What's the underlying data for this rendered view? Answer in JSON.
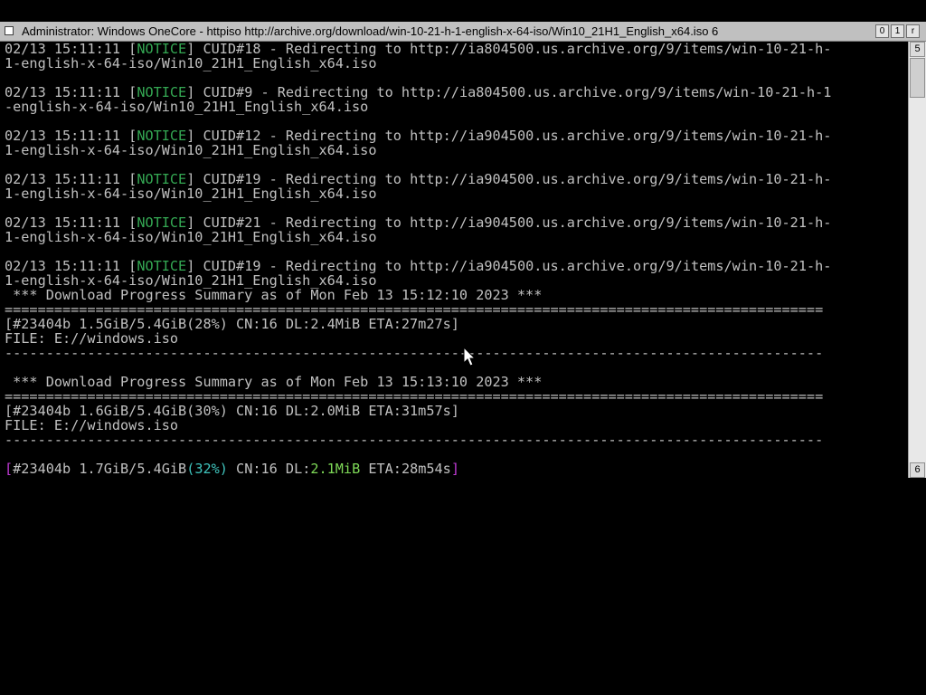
{
  "window": {
    "title": "Administrator:  Windows OneCore - httpiso  http://archive.org/download/win-10-21-h-1-english-x-64-iso/Win10_21H1_English_x64.iso 6",
    "controls": {
      "minimize": "0",
      "maximize": "1",
      "close": "r"
    }
  },
  "console": {
    "log": [
      {
        "time": "02/13 15:11:11",
        "level": "NOTICE",
        "msg": " CUID#18 - Redirecting to http://ia804500.us.archive.org/9/items/win-10-21-h-",
        "wrap": "1-english-x-64-iso/Win10_21H1_English_x64.iso"
      },
      {
        "time": "02/13 15:11:11",
        "level": "NOTICE",
        "msg": " CUID#9 - Redirecting to http://ia804500.us.archive.org/9/items/win-10-21-h-1",
        "wrap": "-english-x-64-iso/Win10_21H1_English_x64.iso"
      },
      {
        "time": "02/13 15:11:11",
        "level": "NOTICE",
        "msg": " CUID#12 - Redirecting to http://ia904500.us.archive.org/9/items/win-10-21-h-",
        "wrap": "1-english-x-64-iso/Win10_21H1_English_x64.iso"
      },
      {
        "time": "02/13 15:11:11",
        "level": "NOTICE",
        "msg": " CUID#19 - Redirecting to http://ia904500.us.archive.org/9/items/win-10-21-h-",
        "wrap": "1-english-x-64-iso/Win10_21H1_English_x64.iso"
      },
      {
        "time": "02/13 15:11:11",
        "level": "NOTICE",
        "msg": " CUID#21 - Redirecting to http://ia904500.us.archive.org/9/items/win-10-21-h-",
        "wrap": "1-english-x-64-iso/Win10_21H1_English_x64.iso"
      },
      {
        "time": "02/13 15:11:11",
        "level": "NOTICE",
        "msg": " CUID#19 - Redirecting to http://ia904500.us.archive.org/9/items/win-10-21-h-",
        "wrap": "1-english-x-64-iso/Win10_21H1_English_x64.iso"
      }
    ],
    "summaries": [
      {
        "header": " *** Download Progress Summary as of Mon Feb 13 15:12:10 2023 ***",
        "rule": "===================================================================================================",
        "progress": "[#23404b 1.5GiB/5.4GiB(28%) CN:16 DL:2.4MiB ETA:27m27s]",
        "file": "FILE: E://windows.iso",
        "dash": "---------------------------------------------------------------------------------------------------"
      },
      {
        "header": " *** Download Progress Summary as of Mon Feb 13 15:13:10 2023 ***",
        "rule": "===================================================================================================",
        "progress": "[#23404b 1.6GiB/5.4GiB(30%) CN:16 DL:2.0MiB ETA:31m57s]",
        "file": "FILE: E://windows.iso",
        "dash": "---------------------------------------------------------------------------------------------------"
      }
    ],
    "live": {
      "open": "[",
      "gid": "#23404b",
      "size": " 1.7GiB/5.4GiB",
      "percent": "(32%)",
      "cn": " CN:16",
      "dl_label": " DL:",
      "dl_value": "2.1MiB",
      "eta": " ETA:28m54s",
      "close": "]"
    }
  },
  "scrollbar": {
    "up_arrow": "5",
    "down_arrow": "6"
  },
  "colors": {
    "notice": "#34a853",
    "bracket": "#c23ad6",
    "percent": "#3fc4bd",
    "speed": "#7ed957",
    "text": "#c0c0c0"
  }
}
